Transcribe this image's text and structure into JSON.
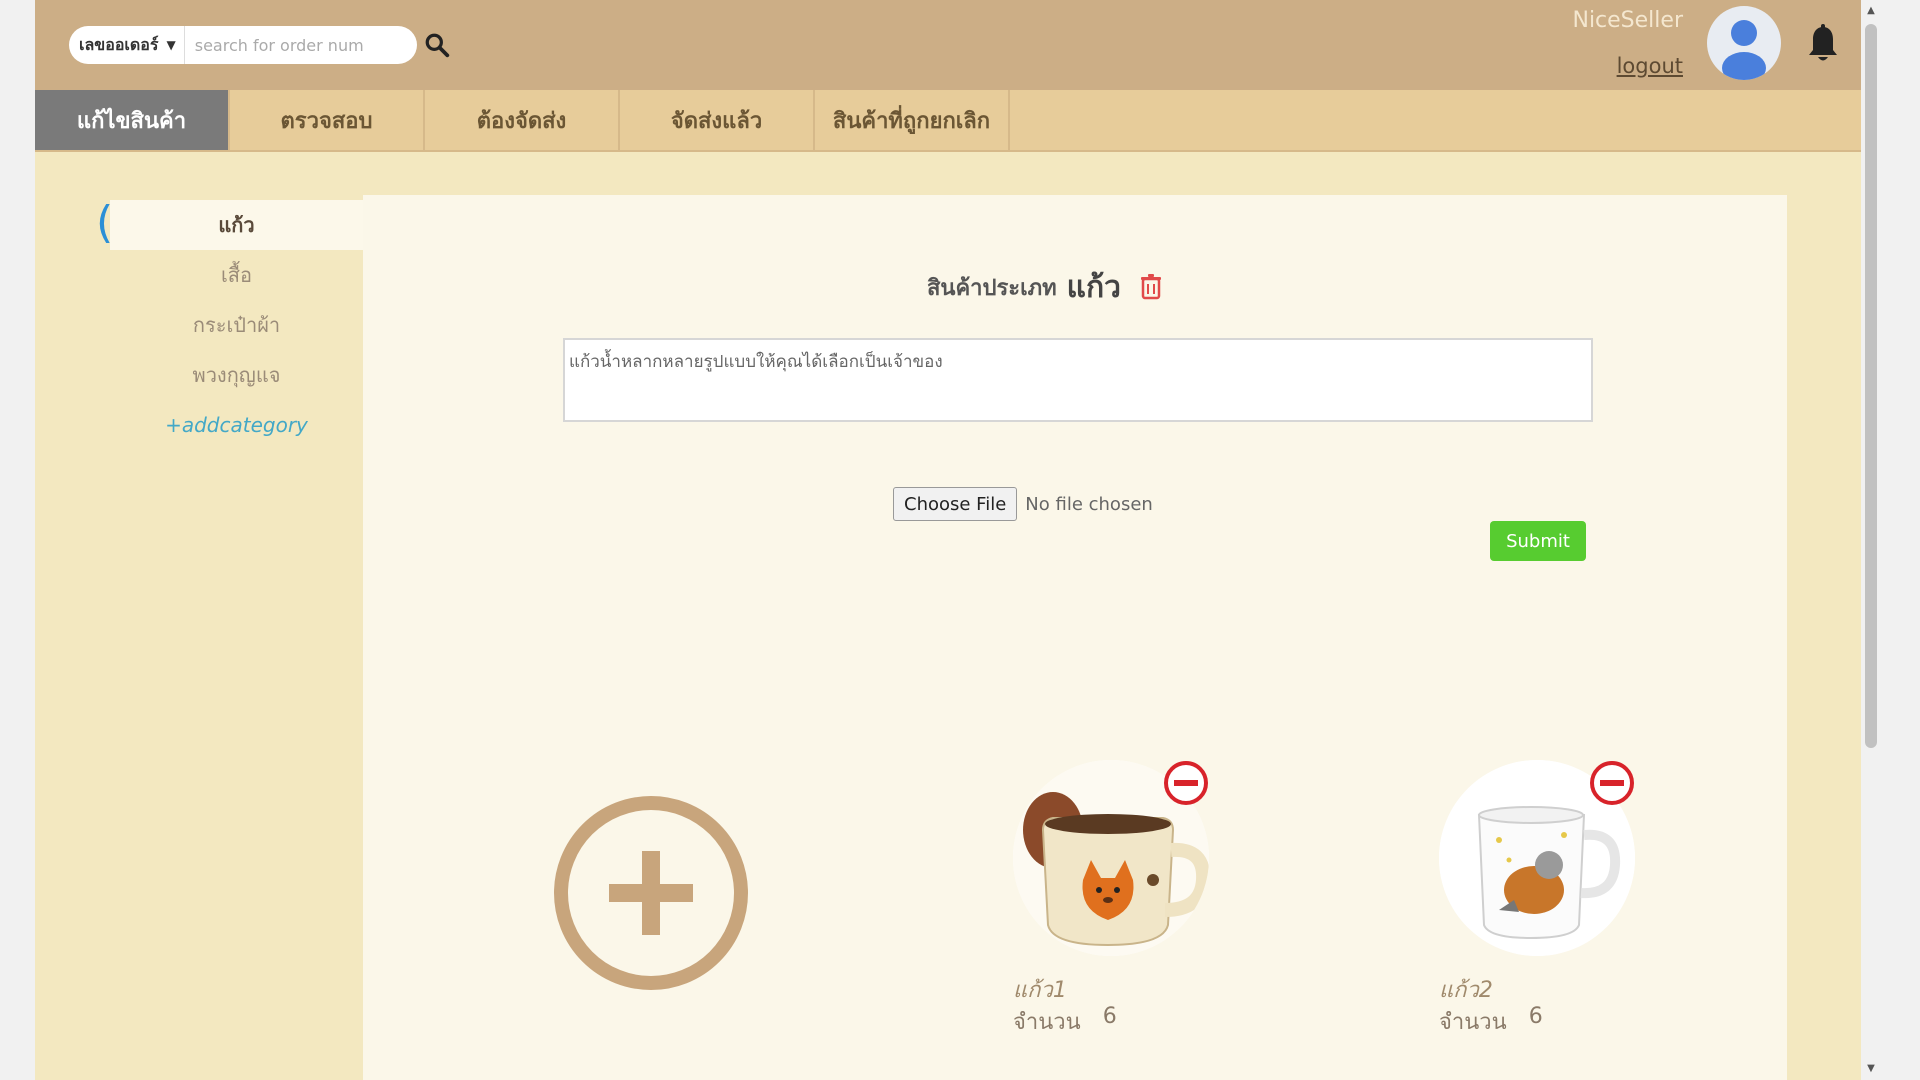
{
  "header": {
    "search_filter": "เลขออเดอร์",
    "search_placeholder": "search for order num",
    "seller_name": "NiceSeller",
    "logout_label": "logout"
  },
  "tabs": [
    {
      "label": "แก้ไขสินค้า",
      "active": true
    },
    {
      "label": "ตรวจสอบ",
      "active": false
    },
    {
      "label": "ต้องจัดส่ง",
      "active": false
    },
    {
      "label": "จัดส่งแล้ว",
      "active": false
    },
    {
      "label": "สินค้าที่ถูกยกเลิก",
      "active": false
    }
  ],
  "sidebar": {
    "categories": [
      {
        "label": "แก้ว",
        "active": true
      },
      {
        "label": "เสื้อ",
        "active": false
      },
      {
        "label": "กระเป๋าผ้า",
        "active": false
      },
      {
        "label": "พวงกุญแจ",
        "active": false
      }
    ],
    "add_category_label": "+addcategory"
  },
  "main": {
    "title_prefix": "สินค้าประเภท",
    "category_name": "แก้ว",
    "description": "แก้วน้ำหลากหลายรูปแบบให้คุณได้เลือกเป็นเจ้าของ",
    "file_button_label": "Choose File",
    "file_status": "No file chosen",
    "submit_label": "Submit",
    "products": [
      {
        "name": "แก้ว1",
        "qty_label": "จำนวน",
        "qty": "6"
      },
      {
        "name": "แก้ว2",
        "qty_label": "จำนวน",
        "qty": "6"
      }
    ]
  },
  "colors": {
    "topbar": "#ccae86",
    "tabbar": "#e7cc9a",
    "active_tab": "#7a7a7a",
    "page_bg": "#f3e8c0",
    "panel_bg": "#fbf7e9",
    "submit": "#57cc30",
    "remove": "#d8232a",
    "add_circle": "#c8a57c",
    "avatar": "#4a7fdc"
  },
  "icons": {
    "search": "search-icon",
    "bell": "bell-icon",
    "avatar": "user-avatar-icon",
    "trash": "trash-icon",
    "add": "plus-circle-icon",
    "remove": "minus-circle-icon"
  }
}
